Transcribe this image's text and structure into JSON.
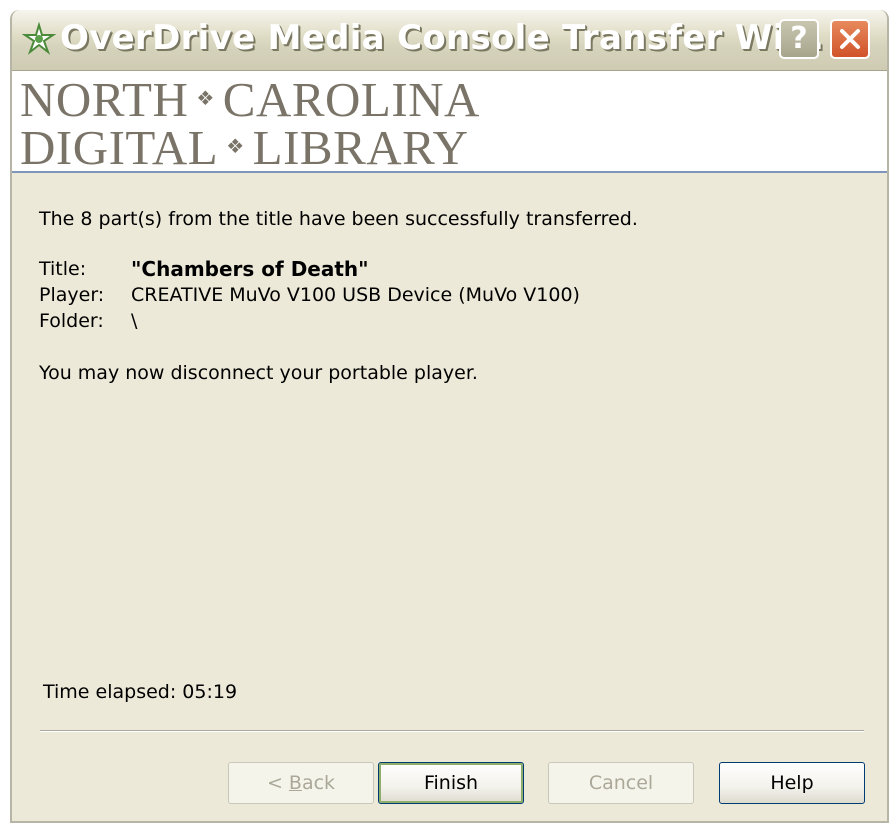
{
  "window": {
    "title": "OverDrive Media Console Transfer Wi...",
    "help_glyph": "?"
  },
  "banner": {
    "line1_left": "NORTH",
    "line1_right": "CAROLINA",
    "line2_left": "DIGITAL",
    "line2_right": "LIBRARY",
    "separator": "❖"
  },
  "content": {
    "status_message": "The 8 part(s) from the title have been successfully transferred.",
    "title_label": "Title:",
    "title_value": "\"Chambers of Death\"",
    "player_label": "Player:",
    "player_value": "CREATIVE MuVo V100 USB Device (MuVo V100)",
    "folder_label": "Folder:",
    "folder_value": "\\",
    "disconnect_message": "You may now disconnect your portable player.",
    "time_elapsed": "Time elapsed: 05:19"
  },
  "buttons": {
    "back_prefix": "< ",
    "back_underlined": "B",
    "back_rest": "ack",
    "finish": "Finish",
    "cancel": "Cancel",
    "help": "Help"
  },
  "colors": {
    "dialog_bg": "#ece9d8",
    "close_button": "#d1532a",
    "banner_text": "#7a7367"
  }
}
